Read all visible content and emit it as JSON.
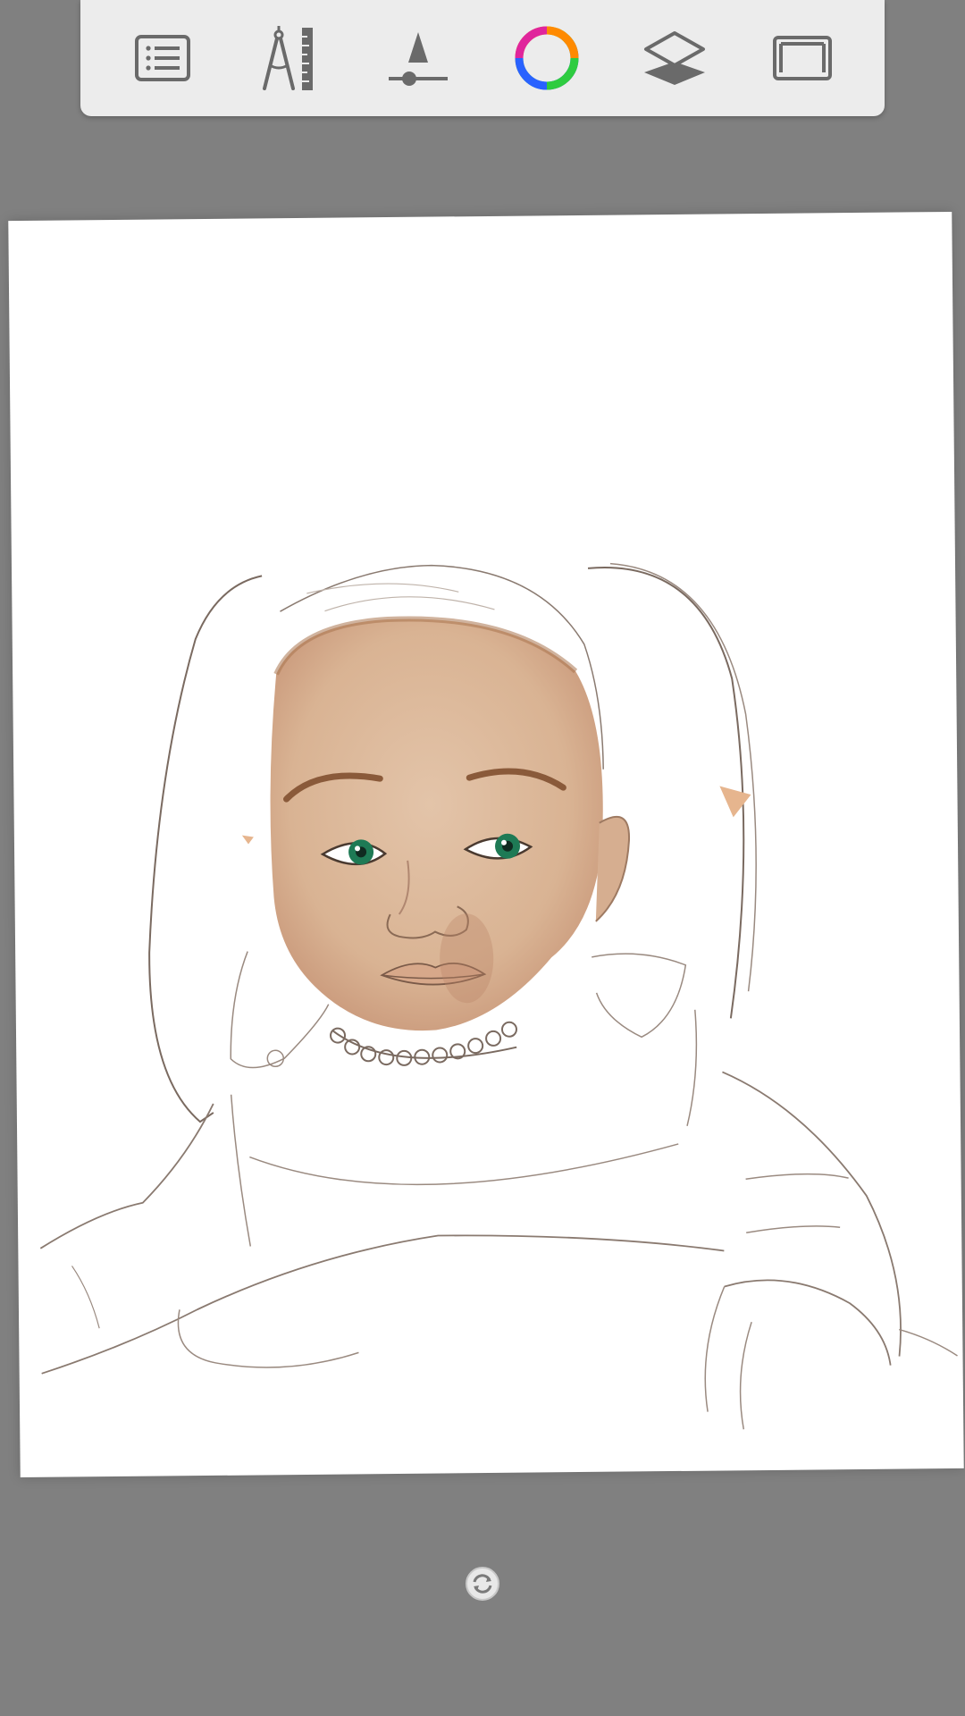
{
  "app": {
    "background": "#808080",
    "toolbar_bg": "#ececec"
  },
  "toolbar": {
    "tools": [
      {
        "name": "menu-list-icon",
        "tooltip": ""
      },
      {
        "name": "ruler-compass-icon",
        "tooltip": ""
      },
      {
        "name": "brush-size-icon",
        "tooltip": ""
      },
      {
        "name": "color-wheel-icon",
        "tooltip": ""
      },
      {
        "name": "layers-icon",
        "tooltip": ""
      },
      {
        "name": "fullscreen-frame-icon",
        "tooltip": ""
      }
    ]
  },
  "canvas": {
    "background": "#ffffff",
    "artwork": "baby-portrait-sketch",
    "skin_color": "#dcb496",
    "line_color": "#6f625a",
    "eye_color": "#1e7a55"
  },
  "rotate_handle": {
    "icon": "rotate-reset-icon"
  }
}
